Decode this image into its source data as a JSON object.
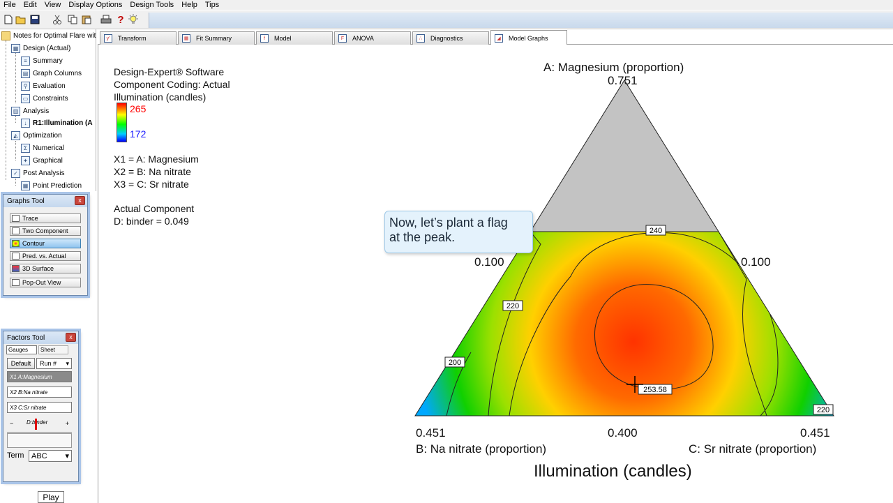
{
  "menu": [
    "File",
    "Edit",
    "View",
    "Display Options",
    "Design Tools",
    "Help",
    "Tips"
  ],
  "toolbar": {
    "icons": [
      "new-file-icon",
      "open-folder-icon",
      "save-icon",
      "cut-icon",
      "copy-icon",
      "paste-icon",
      "print-icon",
      "help-icon",
      "tip-lightbulb-icon"
    ]
  },
  "tree": {
    "root": "Notes for Optimal Flare wit",
    "design": "Design (Actual)",
    "summary": "Summary",
    "graph_columns": "Graph Columns",
    "evaluation": "Evaluation",
    "constraints": "Constraints",
    "analysis": "Analysis",
    "response": "R1:Illumination (A",
    "optimization": "Optimization",
    "numerical": "Numerical",
    "graphical": "Graphical",
    "post_analysis": "Post Analysis",
    "point_prediction": "Point Prediction"
  },
  "graphs_tool": {
    "title": "Graphs Tool",
    "close": "x",
    "buttons": [
      "Trace",
      "Two Component",
      "Contour",
      "Pred. vs. Actual",
      "3D Surface"
    ],
    "popout": "Pop-Out View",
    "active": "Contour"
  },
  "factors_tool": {
    "title": "Factors Tool",
    "close": "x",
    "tab_gauges": "Gauges",
    "tab_sheet": "Sheet",
    "default": "Default",
    "run": "Run #",
    "x1": "X1  A:Magnesium",
    "x2": "X2  B:Na nitrate",
    "x3": "X3  C:Sr nitrate",
    "slider_minus": "−",
    "slider_label": "D:binder",
    "slider_plus": "+",
    "term_label": "Term",
    "term_value": "ABC"
  },
  "play": "Play",
  "tabs": [
    "Transform",
    "Fit Summary",
    "Model",
    "ANOVA",
    "Diagnostics",
    "Model Graphs"
  ],
  "active_tab": "Model Graphs",
  "info": {
    "line1": "Design-Expert® Software",
    "line2": "Component Coding: Actual",
    "line3": "Illumination (candles)",
    "legend_high": "265",
    "legend_low": "172",
    "x1": "X1 = A: Magnesium",
    "x2": "X2 = B: Na nitrate",
    "x3": "X3 = C: Sr nitrate",
    "actual": "Actual Component",
    "binder": "D: binder = 0.049"
  },
  "plot": {
    "top_label": "A: Magnesium (proportion)",
    "top_value": "0.751",
    "left_mid": "0.100",
    "right_mid": "0.100",
    "bottom_left": "0.451",
    "bottom_mid": "0.400",
    "bottom_right": "0.451",
    "b_label": "B: Na nitrate (proportion)",
    "c_label": "C: Sr nitrate (proportion)",
    "title": "Illumination (candles)",
    "contours": [
      "240",
      "220",
      "200",
      "220"
    ],
    "peak_value": "253.58"
  },
  "callout": {
    "line1": "Now, let’s plant a flag",
    "line2": "at the peak."
  },
  "colors": {
    "accent_active_tab_button": "#8fc3ef",
    "legend_high": "#ff0000",
    "legend_low": "#1c1cff"
  }
}
